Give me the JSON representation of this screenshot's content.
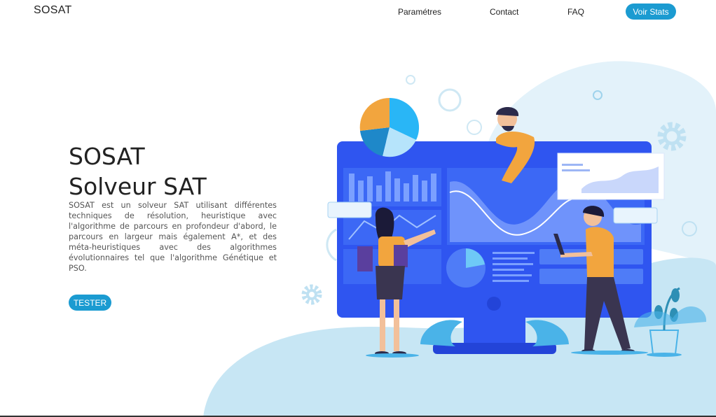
{
  "navbar": {
    "brand": "SOSAT",
    "links": [
      "Paramétres",
      "Contact",
      "FAQ"
    ],
    "stats_button": "Voir Stats"
  },
  "hero": {
    "title_line1": "SOSAT",
    "title_line2": "Solveur SAT",
    "description": "SOSAT est un solveur SAT utilisant différentes techniques de résolution, heuristique avec l'algorithme de parcours en profondeur d'abord, le parcours en largeur mais également A*, et des méta-heuristiques avec des algorithmes évolutionnaires tel que l'algorithme Génétique et PSO.",
    "cta_label": "TESTER"
  },
  "illustration": {
    "icon": "data-analytics-illustration",
    "colors": {
      "accent": "#1b9bd1",
      "screen": "#2f55f0",
      "orange": "#f0a040",
      "light_blue": "#d9eef8"
    }
  }
}
